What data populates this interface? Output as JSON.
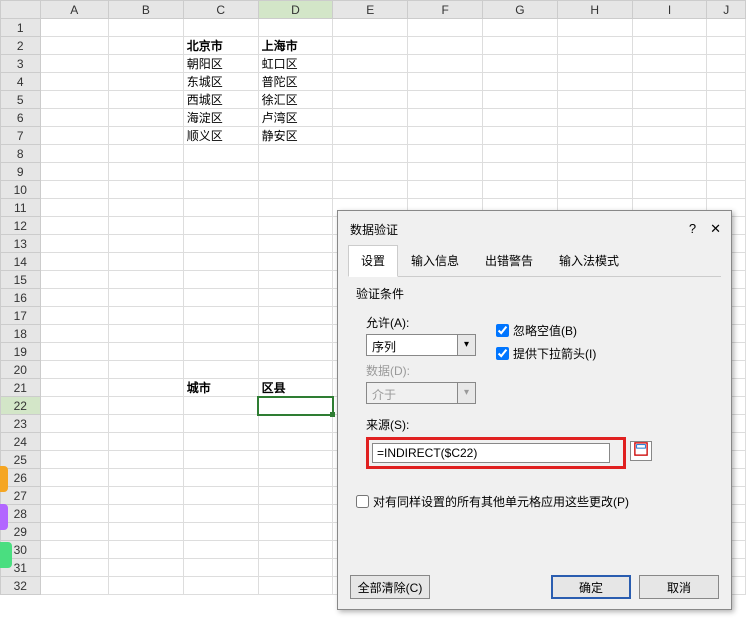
{
  "cols": [
    "A",
    "B",
    "C",
    "D",
    "E",
    "F",
    "G",
    "H",
    "I",
    "J"
  ],
  "rows": [
    1,
    2,
    3,
    4,
    5,
    6,
    7,
    8,
    9,
    10,
    11,
    12,
    13,
    14,
    15,
    16,
    17,
    18,
    19,
    20,
    21,
    22,
    23,
    24,
    25,
    26,
    27,
    28,
    29,
    30,
    31,
    32
  ],
  "cells": {
    "C2": "北京市",
    "D2": "上海市",
    "C3": "朝阳区",
    "D3": "虹口区",
    "C4": "东城区",
    "D4": "普陀区",
    "C5": "西城区",
    "D5": "徐汇区",
    "C6": "海淀区",
    "D6": "卢湾区",
    "C7": "顺义区",
    "D7": "静安区",
    "C21": "城市",
    "D21": "区县"
  },
  "activeCol": "D",
  "activeRow": 22,
  "dialog": {
    "title": "数据验证",
    "help": "?",
    "close": "✕",
    "tabs": [
      "设置",
      "输入信息",
      "出错警告",
      "输入法模式"
    ],
    "activeTab": 0,
    "section": "验证条件",
    "allowLabel": "允许(A):",
    "allowValue": "序列",
    "ignoreBlank": "忽略空值(B)",
    "dropdown": "提供下拉箭头(I)",
    "dataLabel": "数据(D):",
    "dataValue": "介于",
    "sourceLabel": "来源(S):",
    "sourceValue": "=INDIRECT($C22)",
    "applyAll": "对有同样设置的所有其他单元格应用这些更改(P)",
    "clearAll": "全部清除(C)",
    "ok": "确定",
    "cancel": "取消"
  }
}
